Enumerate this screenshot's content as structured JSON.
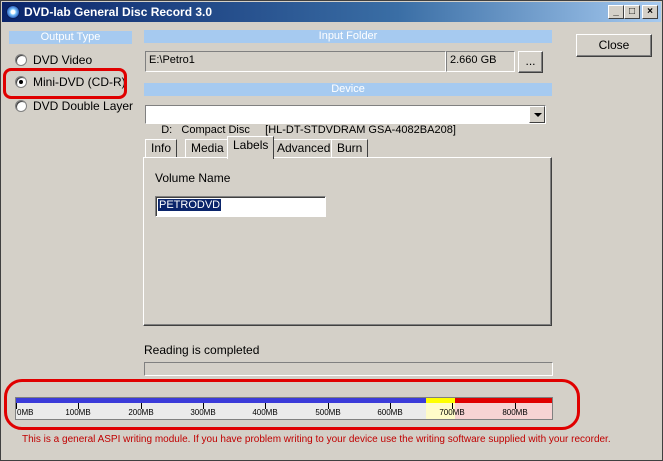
{
  "window": {
    "title": "DVD-lab General Disc Record 3.0"
  },
  "output_type": {
    "header": "Output Type",
    "options": [
      {
        "label": "DVD Video",
        "selected": false
      },
      {
        "label": "Mini-DVD (CD-R)",
        "selected": true
      },
      {
        "label": "DVD Double Layer",
        "selected": false
      }
    ]
  },
  "input_folder": {
    "header": "Input Folder",
    "path": "E:\\Petro1",
    "size": "2.660 GB",
    "browse_label": "..."
  },
  "close_label": "Close",
  "device": {
    "header": "Device",
    "selected": "D:   Compact Disc     [HL-DT-STDVDRAM GSA-4082BA208]"
  },
  "tabs": [
    {
      "label": "Info",
      "active": false
    },
    {
      "label": "Media",
      "active": false
    },
    {
      "label": "Labels",
      "active": true
    },
    {
      "label": "Advanced",
      "active": false
    },
    {
      "label": "Burn",
      "active": false
    }
  ],
  "labels_tab": {
    "volume_name_label": "Volume Name",
    "volume_name_value": "PETRODVD"
  },
  "status": {
    "text": "Reading is completed",
    "progress": 0
  },
  "capacity_bar": {
    "scale_max_mb": 860,
    "used_mb": 658,
    "warn_end_mb": 704,
    "tick_labels": [
      "0MB",
      "100MB",
      "200MB",
      "300MB",
      "400MB",
      "500MB",
      "600MB",
      "700MB",
      "800MB"
    ],
    "colors": {
      "used": "#3b3bd9",
      "warn": "#ffff00",
      "over": "#e00000"
    }
  },
  "footnote": "This is a general ASPI writing module. If you have problem writing to your device use the writing software supplied with your recorder."
}
